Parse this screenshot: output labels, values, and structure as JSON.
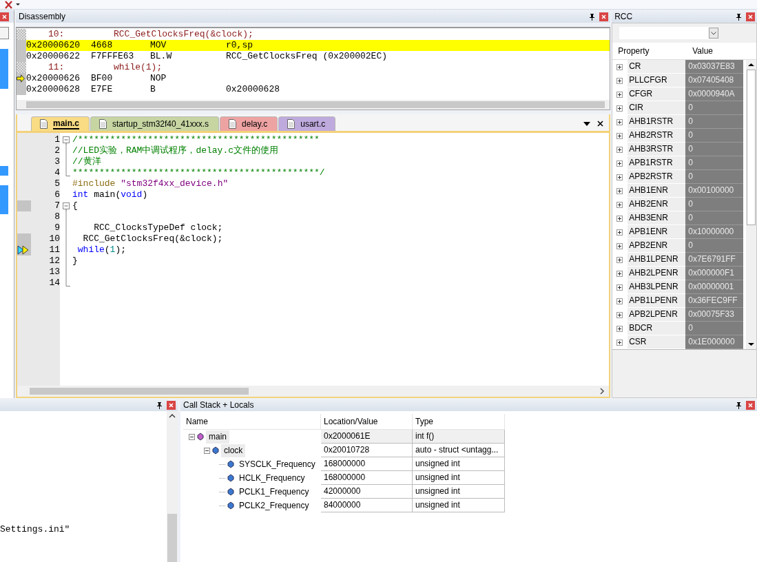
{
  "disassembly": {
    "title": "Disassembly",
    "rows": [
      {
        "kind": "source",
        "line": "10:",
        "code": "RCC_GetClocksFreq(&clock);",
        "highlighted": false,
        "current": false
      },
      {
        "kind": "instr",
        "address": "0x20000620",
        "opcode": "4668",
        "mnemonic": "MOV",
        "operands": "r0,sp",
        "highlighted": true,
        "current": false
      },
      {
        "kind": "instr",
        "address": "0x20000622",
        "opcode": "F7FFFE63",
        "mnemonic": "BL.W",
        "operands": "RCC_GetClocksFreq (0x200002EC)",
        "highlighted": false,
        "current": false
      },
      {
        "kind": "source",
        "line": "11:",
        "code": "while(1);",
        "highlighted": false,
        "current": false
      },
      {
        "kind": "instr",
        "address": "0x20000626",
        "opcode": "BF00",
        "mnemonic": "NOP",
        "highlighted": false,
        "current": true
      },
      {
        "kind": "instr",
        "address": "0x20000628",
        "opcode": "E7FE",
        "mnemonic": "B",
        "operands": "0x20000628",
        "highlighted": false,
        "current": false
      }
    ]
  },
  "editor": {
    "tabs": [
      {
        "label": "main.c",
        "selected": true,
        "color": "#f9dc84"
      },
      {
        "label": "startup_stm32f40_41xxx.s",
        "selected": false,
        "color": "#c6d5a2"
      },
      {
        "label": "delay.c",
        "selected": false,
        "color": "#eea3a3"
      },
      {
        "label": "usart.c",
        "selected": false,
        "color": "#bfaade"
      }
    ],
    "lines": [
      {
        "number": "1",
        "kind": "fold_open",
        "executable": false,
        "current": false,
        "tokens": [
          {
            "kind": "comment",
            "text": "/*********************************************"
          }
        ]
      },
      {
        "number": "2",
        "kind": "fold_line",
        "executable": false,
        "current": false,
        "tokens": [
          {
            "kind": "comment",
            "text": "//LED实验，RAM中调试程序，delay.c文件的使用"
          }
        ]
      },
      {
        "number": "3",
        "kind": "fold_line",
        "executable": false,
        "current": false,
        "tokens": [
          {
            "kind": "comment",
            "text": "//黄洋"
          }
        ]
      },
      {
        "number": "4",
        "kind": "fold_end",
        "executable": false,
        "current": false,
        "tokens": [
          {
            "kind": "comment",
            "text": "**********************************************/"
          }
        ]
      },
      {
        "number": "5",
        "kind": "plain",
        "executable": false,
        "current": false,
        "tokens": [
          {
            "kind": "preproc",
            "text": "#include"
          },
          {
            "kind": "string",
            "text": " \"stm32f4xx_device.h\""
          }
        ]
      },
      {
        "number": "6",
        "kind": "plain",
        "executable": false,
        "current": false,
        "tokens": [
          {
            "kind": "keyword",
            "text": "int"
          },
          {
            "kind": "plain",
            "text": " main("
          },
          {
            "kind": "keyword",
            "text": "void"
          },
          {
            "kind": "plain",
            "text": ")"
          }
        ]
      },
      {
        "number": "7",
        "kind": "fold_open",
        "executable": true,
        "current": false,
        "tokens": [
          {
            "kind": "plain",
            "text": "{"
          }
        ]
      },
      {
        "number": "8",
        "kind": "fold_line",
        "executable": false,
        "current": false
      },
      {
        "number": "9",
        "kind": "fold_line",
        "executable": false,
        "current": false,
        "tokens": [
          {
            "kind": "plain",
            "text": "    RCC_ClocksTypeDef clock;"
          }
        ]
      },
      {
        "number": "10",
        "kind": "fold_line",
        "executable": true,
        "current": false,
        "tokens": [
          {
            "kind": "plain",
            "text": "  RCC_GetClocksFreq(&clock);"
          }
        ]
      },
      {
        "number": "11",
        "kind": "fold_line",
        "executable": true,
        "current": true,
        "tokens": [
          {
            "kind": "keyword",
            "text": " while"
          },
          {
            "kind": "plain",
            "text": "("
          },
          {
            "kind": "number",
            "text": "1"
          },
          {
            "kind": "plain",
            "text": ");"
          }
        ]
      },
      {
        "number": "12",
        "kind": "fold_line",
        "executable": false,
        "current": false,
        "tokens": [
          {
            "kind": "plain",
            "text": "}"
          }
        ]
      },
      {
        "number": "13",
        "kind": "fold_line",
        "executable": false,
        "current": false
      },
      {
        "number": "14",
        "kind": "fold_end",
        "executable": false,
        "current": false
      }
    ]
  },
  "rcc": {
    "title": "RCC",
    "columns": [
      "Property",
      "Value"
    ],
    "rows": [
      {
        "name": "CR",
        "value": "0x03037E83",
        "expanded": false
      },
      {
        "name": "PLLCFGR",
        "value": "0x07405408",
        "expanded": false
      },
      {
        "name": "CFGR",
        "value": "0x0000940A",
        "expanded": false
      },
      {
        "name": "CIR",
        "value": "0",
        "expanded": false
      },
      {
        "name": "AHB1RSTR",
        "value": "0",
        "expanded": false
      },
      {
        "name": "AHB2RSTR",
        "value": "0",
        "expanded": false
      },
      {
        "name": "AHB3RSTR",
        "value": "0",
        "expanded": false
      },
      {
        "name": "APB1RSTR",
        "value": "0",
        "expanded": false
      },
      {
        "name": "APB2RSTR",
        "value": "0",
        "expanded": false
      },
      {
        "name": "AHB1ENR",
        "value": "0x00100000",
        "expanded": false
      },
      {
        "name": "AHB2ENR",
        "value": "0",
        "expanded": false
      },
      {
        "name": "AHB3ENR",
        "value": "0",
        "expanded": false
      },
      {
        "name": "APB1ENR",
        "value": "0x10000000",
        "expanded": false
      },
      {
        "name": "APB2ENR",
        "value": "0",
        "expanded": false
      },
      {
        "name": "AHB1LPENR",
        "value": "0x7E6791FF",
        "expanded": false
      },
      {
        "name": "AHB2LPENR",
        "value": "0x000000F1",
        "expanded": false
      },
      {
        "name": "AHB3LPENR",
        "value": "0x00000001",
        "expanded": false
      },
      {
        "name": "APB1LPENR",
        "value": "0x36FEC9FF",
        "expanded": false
      },
      {
        "name": "APB2LPENR",
        "value": "0x00075F33",
        "expanded": false
      },
      {
        "name": "BDCR",
        "value": "0",
        "expanded": false
      },
      {
        "name": "CSR",
        "value": "0x1E000000",
        "expanded": false
      }
    ]
  },
  "output": {
    "text": "Settings.ini\""
  },
  "call_stack": {
    "title": "Call Stack + Locals",
    "columns": [
      "Name",
      "Location/Value",
      "Type"
    ],
    "rows": [
      {
        "kind": "function",
        "name": "main",
        "value": "0x2000061E",
        "type": "int f()",
        "expanded": true,
        "children": [
          {
            "kind": "variable",
            "name": "clock",
            "value": "0x20010728",
            "type": "auto - struct <untagg...",
            "expanded": true,
            "children": [
              {
                "kind": "variable",
                "name": "SYSCLK_Frequency",
                "value": "168000000",
                "type": "unsigned int"
              },
              {
                "kind": "variable",
                "name": "HCLK_Frequency",
                "value": "168000000",
                "type": "unsigned int"
              },
              {
                "kind": "variable",
                "name": "PCLK1_Frequency",
                "value": "42000000",
                "type": "unsigned int"
              },
              {
                "kind": "variable",
                "name": "PCLK2_Frequency",
                "value": "84000000",
                "type": "unsigned int"
              }
            ]
          }
        ]
      }
    ]
  }
}
